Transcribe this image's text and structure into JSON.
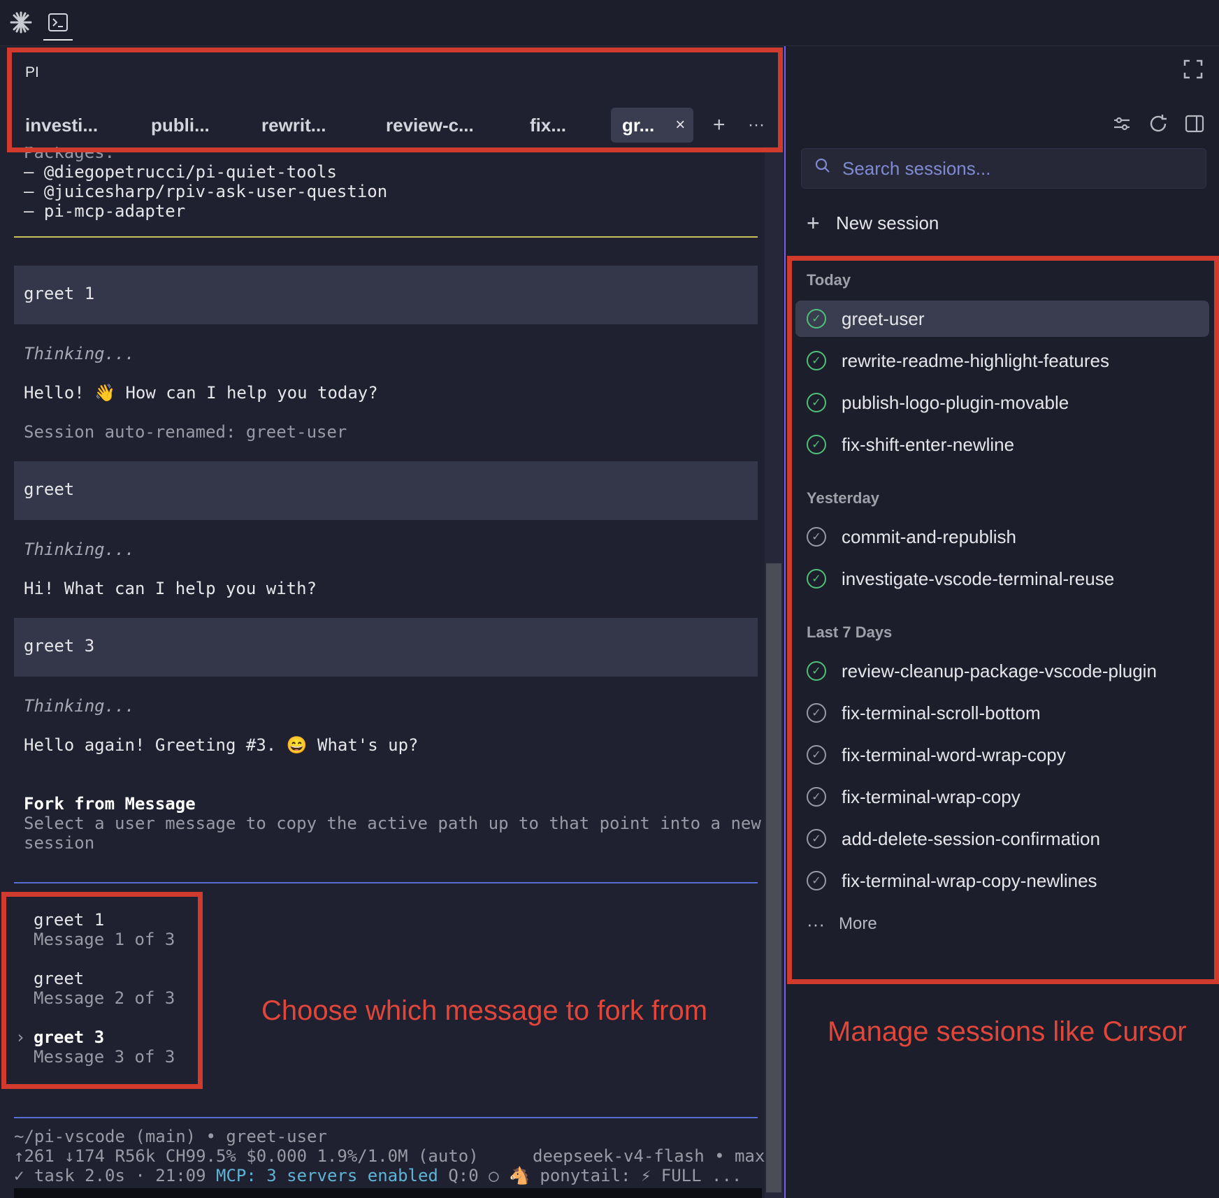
{
  "activity_bar": {
    "icons": [
      "starburst-icon",
      "terminal-icon"
    ]
  },
  "panel": {
    "title": "PI",
    "tabs": [
      {
        "label": "investi..."
      },
      {
        "label": "publi..."
      },
      {
        "label": "rewrit..."
      },
      {
        "label": "review-c..."
      },
      {
        "label": "fix..."
      },
      {
        "label": "gr..."
      }
    ],
    "close_symbol": "×",
    "add_symbol": "+",
    "more_symbol": "···"
  },
  "terminal": {
    "packages_header": "Packages:",
    "packages": [
      "– @diegopetrucci/pi-quiet-tools",
      "– @juicesharp/rpiv-ask-user-question",
      "– pi-mcp-adapter"
    ],
    "conversation": {
      "user_1": "greet 1",
      "thinking": "Thinking...",
      "reply_1": "Hello! 👋 How can I help you today?",
      "rename_note": "Session auto-renamed: greet-user",
      "user_2": "greet",
      "reply_2": "Hi! What can I help you with?",
      "user_3": "greet 3",
      "reply_3": "Hello again! Greeting #3. 😄 What's up?"
    },
    "fork": {
      "title": "Fork from Message",
      "description_1": "Select a user message to copy the active path up to that point into a new",
      "description_2": "session",
      "items": [
        {
          "label": "greet 1",
          "sub": "Message 1 of 3"
        },
        {
          "label": "greet",
          "sub": "Message 2 of 3"
        },
        {
          "label": "greet 3",
          "sub": "Message 3 of 3"
        }
      ],
      "selected_marker": "›"
    },
    "status": {
      "line_1": "~/pi-vscode (main) • greet-user",
      "line_2_left": "↑261 ↓174 R56k CH99.5% $0.000 1.9%/1.0M (auto)",
      "line_2_right": "deepseek-v4-flash • max",
      "line_3_task": "✓ task 2.0s · 21:09",
      "line_3_mcp": "MCP: 3 servers enabled",
      "line_3_rest": "Q:0 ○ 🐴 ponytail: ⚡ FULL ..."
    }
  },
  "sidebar": {
    "search_placeholder": "Search sessions...",
    "new_session_label": "New session",
    "sections": [
      {
        "label": "Today",
        "items": [
          {
            "name": "greet-user",
            "status": "green"
          },
          {
            "name": "rewrite-readme-highlight-features",
            "status": "green"
          },
          {
            "name": "publish-logo-plugin-movable",
            "status": "green"
          },
          {
            "name": "fix-shift-enter-newline",
            "status": "green"
          }
        ]
      },
      {
        "label": "Yesterday",
        "items": [
          {
            "name": "commit-and-republish",
            "status": "grey"
          },
          {
            "name": "investigate-vscode-terminal-reuse",
            "status": "green"
          }
        ]
      },
      {
        "label": "Last 7 Days",
        "items": [
          {
            "name": "review-cleanup-package-vscode-plugin",
            "status": "green"
          },
          {
            "name": "fix-terminal-scroll-bottom",
            "status": "grey"
          },
          {
            "name": "fix-terminal-word-wrap-copy",
            "status": "grey"
          },
          {
            "name": "fix-terminal-wrap-copy",
            "status": "grey"
          },
          {
            "name": "add-delete-session-confirmation",
            "status": "grey"
          },
          {
            "name": "fix-terminal-wrap-copy-newlines",
            "status": "grey"
          }
        ]
      }
    ],
    "more_label": "More"
  },
  "annotations": {
    "fork_caption": "Choose which message to fork from",
    "sessions_caption": "Manage sessions like Cursor"
  },
  "colors": {
    "annotation_red": "#d03b2e",
    "status_green": "#4fbf7a",
    "accent_purple": "#7a5cf5"
  }
}
